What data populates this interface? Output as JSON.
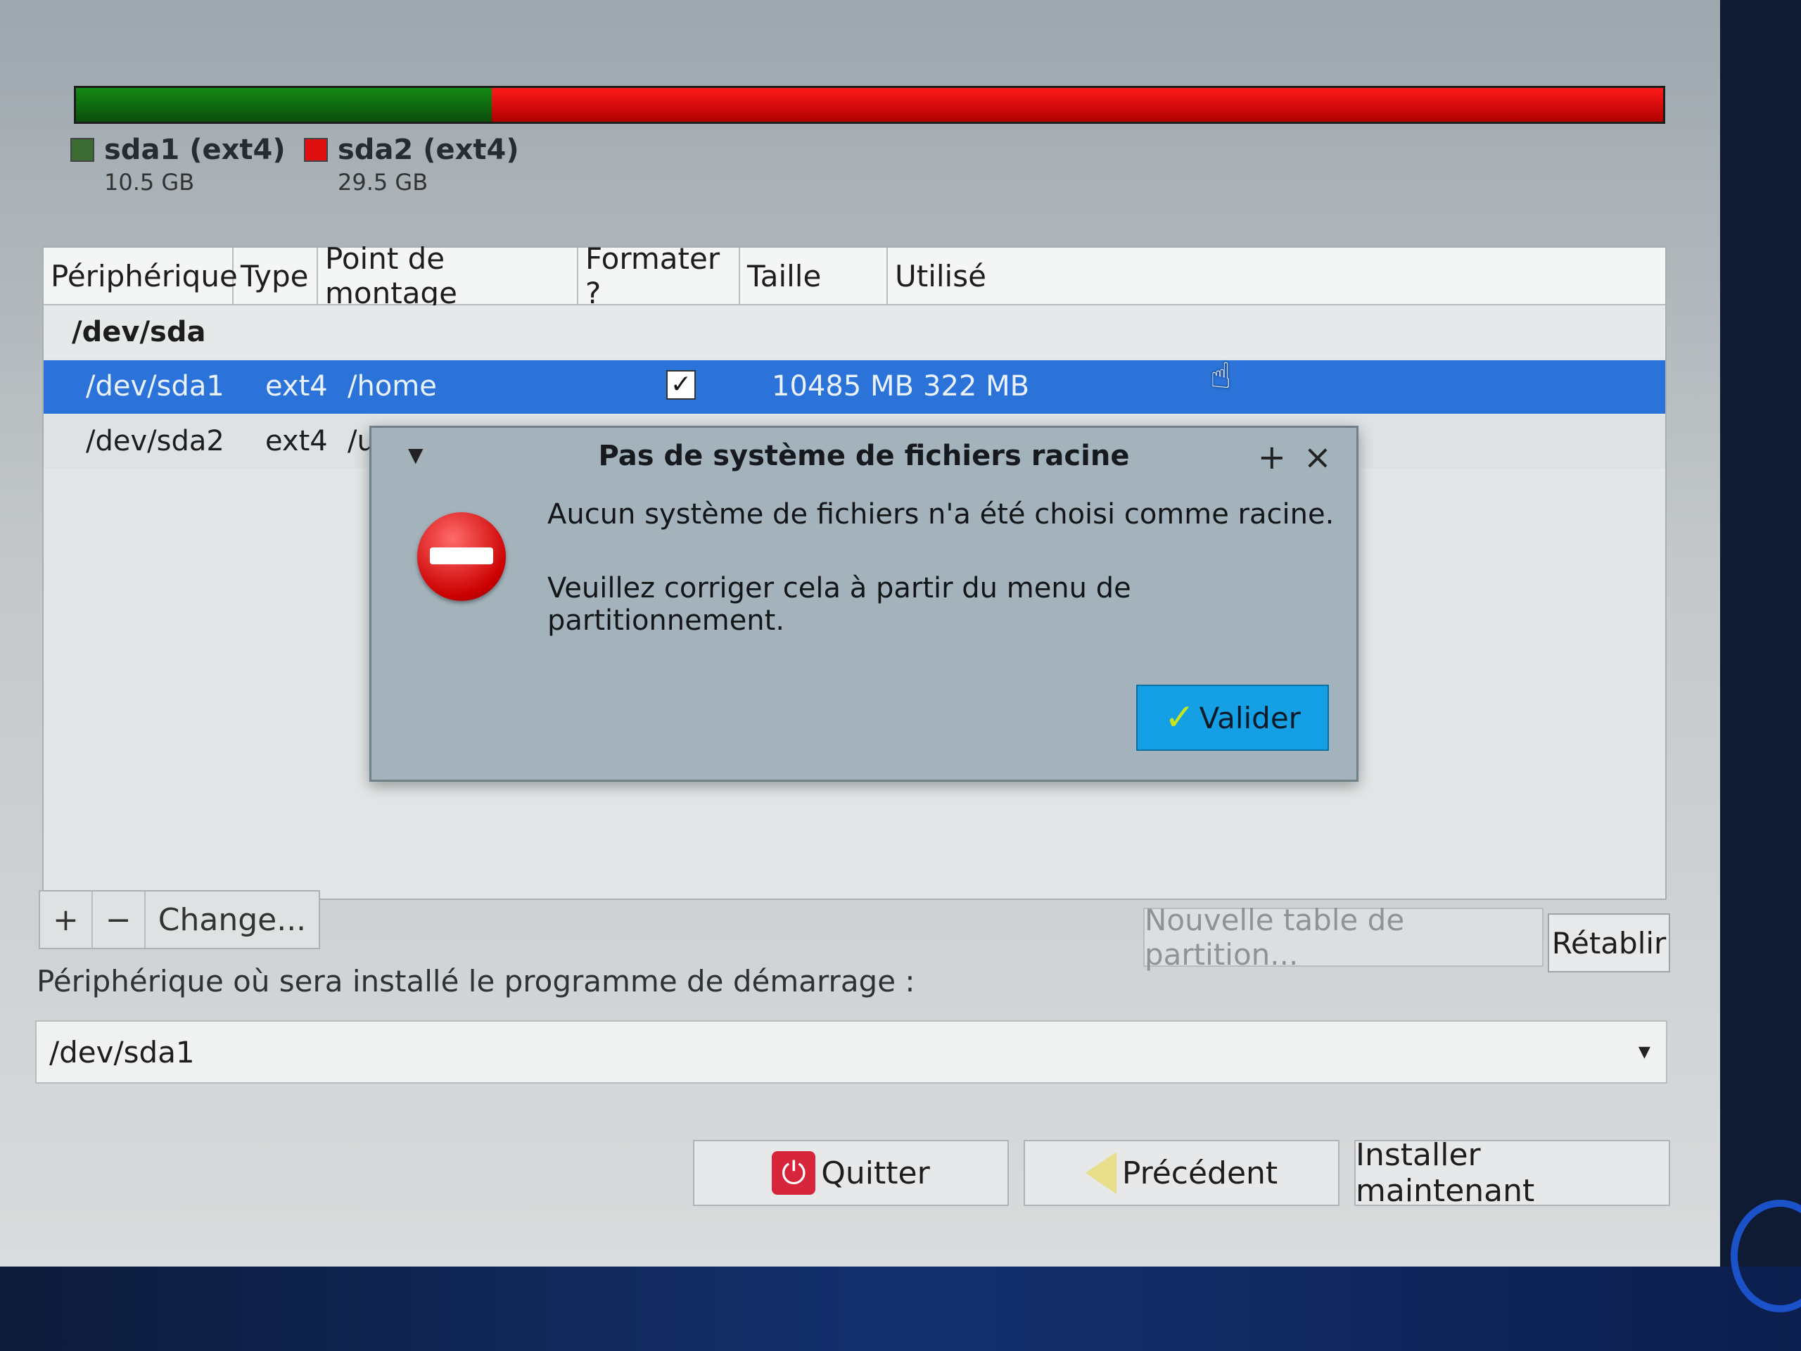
{
  "partitions": [
    {
      "name": "sda1 (ext4)",
      "size": "10.5 GB",
      "color": "#138a13",
      "share": 0.262
    },
    {
      "name": "sda2 (ext4)",
      "size": "29.5 GB",
      "color": "#e01010",
      "share": 0.738
    }
  ],
  "table": {
    "headers": [
      "Périphérique",
      "Type",
      "Point de montage",
      "Formater ?",
      "Taille",
      "Utilisé"
    ],
    "disk": "/dev/sda",
    "rows": [
      {
        "device": "/dev/sda1",
        "type": "ext4",
        "mount": "/home",
        "format": true,
        "size": "10485 MB",
        "used": "322 MB",
        "selected": true
      },
      {
        "device": "/dev/sda2",
        "type": "ext4",
        "mount": "/u",
        "format": false,
        "size": "",
        "used": "",
        "selected": false
      }
    ]
  },
  "toolbar": {
    "add": "+",
    "remove": "−",
    "change": "Change...",
    "new_table": "Nouvelle table de partition...",
    "reset": "Rétablir"
  },
  "boot": {
    "label": "Périphérique où sera installé le programme de démarrage :",
    "value": "/dev/sda1"
  },
  "buttons": {
    "quit": "Quitter",
    "back": "Précédent",
    "install": "Installer maintenant"
  },
  "dialog": {
    "title": "Pas de système de fichiers racine",
    "message1": "Aucun système de fichiers n'a été choisi comme racine.",
    "message2": "Veuillez corriger cela à partir du menu de partitionnement.",
    "ok": "Valider",
    "plus": "+",
    "close": "×"
  }
}
